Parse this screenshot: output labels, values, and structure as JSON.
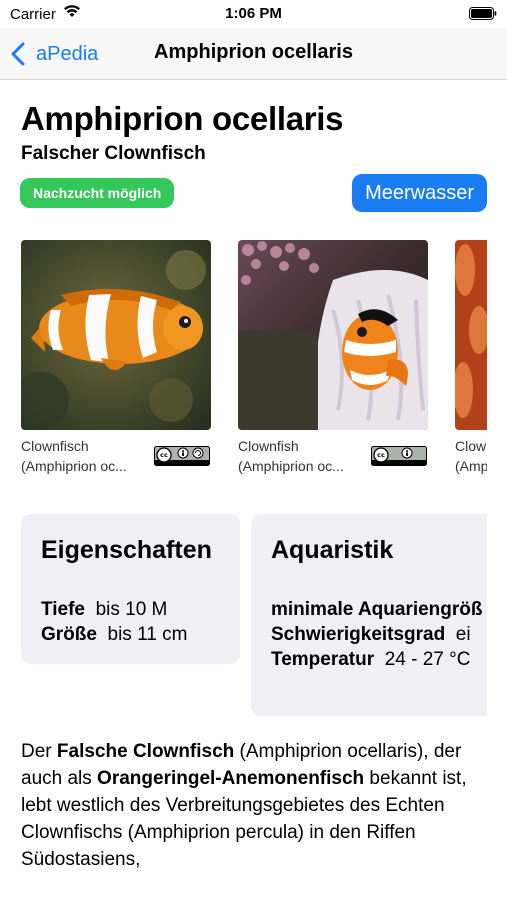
{
  "status_bar": {
    "carrier": "Carrier",
    "time": "1:06 PM"
  },
  "nav": {
    "back_label": "aPedia",
    "title": "Amphiprion ocellaris"
  },
  "header": {
    "title": "Amphiprion ocellaris",
    "subtitle": "Falscher Clownfisch",
    "badge": "Nachzucht möglich",
    "water_type": "Meerwasser"
  },
  "gallery": [
    {
      "caption_line1": "Clownfisch",
      "caption_line2": "(Amphiprion oc...",
      "license_icon": "cc-by-sa-icon"
    },
    {
      "caption_line1": "Clownfish",
      "caption_line2": "(Amphiprion oc...",
      "license_icon": "cc-by-icon"
    },
    {
      "caption_line1": "Clow",
      "caption_line2": "(Amp"
    }
  ],
  "properties": {
    "title": "Eigenschaften",
    "rows": [
      {
        "label": "Tiefe",
        "value": "bis 10 M"
      },
      {
        "label": "Größe",
        "value": "bis 11 cm"
      }
    ]
  },
  "aquaristics": {
    "title": "Aquaristik",
    "rows": [
      {
        "label": "minimale Aquariengröß",
        "value": ""
      },
      {
        "label": "Schwierigkeitsgrad",
        "value": "ei"
      },
      {
        "label": "Temperatur",
        "value": "24 - 27 °C"
      }
    ]
  },
  "description": {
    "p1": "Der ",
    "b1": "Falsche Clownfisch",
    "p2": " (Amphiprion ocellaris), der auch als ",
    "b2": "Orangeringel-Anemonenfisch",
    "p3": " bekannt ist, lebt westlich des Verbreitungsgebietes des Echten Clownfischs (Amphiprion percula) in den Riffen Südostasiens,"
  },
  "colors": {
    "accent": "#1a7cf2",
    "badge_green": "#34c759",
    "card_bg": "#efeff4"
  }
}
